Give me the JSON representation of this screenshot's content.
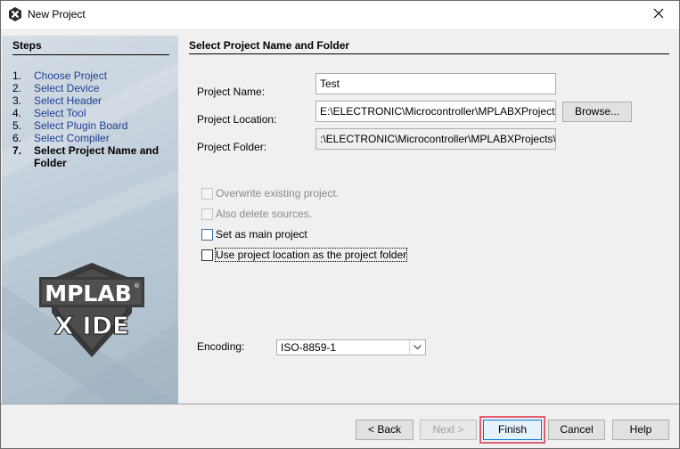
{
  "window": {
    "title": "New Project",
    "app_icon": "mplab-x-icon",
    "close_icon": "close-icon"
  },
  "steps": {
    "title": "Steps",
    "items": [
      {
        "num": "1.",
        "label": "Choose Project",
        "current": false
      },
      {
        "num": "2.",
        "label": "Select Device",
        "current": false
      },
      {
        "num": "3.",
        "label": "Select Header",
        "current": false
      },
      {
        "num": "4.",
        "label": "Select Tool",
        "current": false
      },
      {
        "num": "5.",
        "label": "Select Plugin Board",
        "current": false
      },
      {
        "num": "6.",
        "label": "Select Compiler",
        "current": false
      },
      {
        "num": "7.",
        "label": "Select Project Name and Folder",
        "current": true
      }
    ],
    "logo_top": "MPLAB",
    "logo_reg": "®",
    "logo_bottom": "X IDE"
  },
  "main": {
    "title": "Select Project Name and Folder",
    "project_name_label": "Project Name:",
    "project_name_value": "Test",
    "project_location_label": "Project Location:",
    "project_location_value": "E:\\ELECTRONIC\\Microcontroller\\MPLABXProjects",
    "browse_label": "Browse...",
    "project_folder_label": "Project Folder:",
    "project_folder_value": ":\\ELECTRONIC\\Microcontroller\\MPLABXProjects\\Test.X",
    "options": {
      "overwrite": "Overwrite existing project.",
      "delete_sources": "Also delete sources.",
      "main_project": "Set as main project",
      "use_location": "Use project location as the project folder"
    },
    "encoding_label": "Encoding:",
    "encoding_value": "ISO-8859-1"
  },
  "footer": {
    "back": "< Back",
    "next": "Next >",
    "finish": "Finish",
    "cancel": "Cancel",
    "help": "Help"
  },
  "colors": {
    "highlight": "#e06072",
    "step_link": "#1c3f94",
    "focus_border": "#0078d7"
  }
}
